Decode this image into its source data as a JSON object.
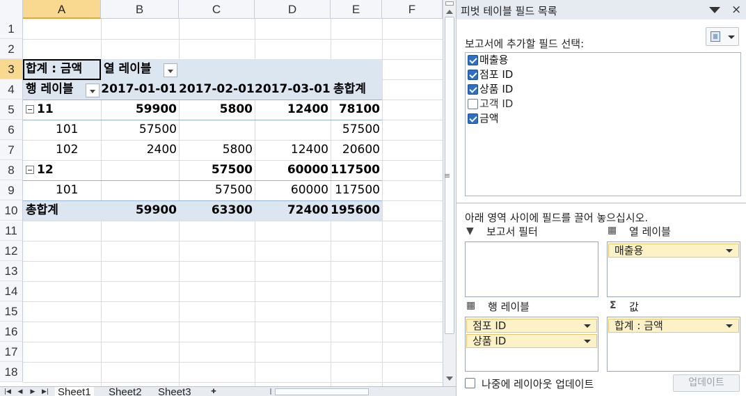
{
  "sheet": {
    "columns": [
      "A",
      "B",
      "C",
      "D",
      "E",
      "F"
    ],
    "rows": [
      "1",
      "2",
      "3",
      "4",
      "5",
      "6",
      "7",
      "8",
      "9",
      "10",
      "11",
      "12",
      "13",
      "14",
      "15",
      "16",
      "17",
      "18"
    ],
    "pivot": {
      "values_label": "합계 : 금액",
      "col_labels_header": "열 레이블",
      "row_labels_header": "행 레이블",
      "col_headers": [
        "2017-01-01",
        "2017-02-01",
        "2017-03-01",
        "총합계"
      ],
      "store_11": {
        "label": "11",
        "vals": [
          "59900",
          "5800",
          "12400",
          "78100"
        ]
      },
      "r101a": {
        "label": "101",
        "vals": [
          "57500",
          "",
          "",
          "57500"
        ]
      },
      "r102": {
        "label": "102",
        "vals": [
          "2400",
          "5800",
          "12400",
          "20600"
        ]
      },
      "store_12": {
        "label": "12",
        "vals": [
          "",
          "57500",
          "60000",
          "117500"
        ]
      },
      "r101b": {
        "label": "101",
        "vals": [
          "",
          "57500",
          "60000",
          "117500"
        ]
      },
      "grand": {
        "label": "총합계",
        "vals": [
          "59900",
          "63300",
          "72400",
          "195600"
        ]
      }
    },
    "tabs": [
      "Sheet1",
      "Sheet2",
      "Sheet3"
    ]
  },
  "pane": {
    "title": "피벗 테이블 필드 목록",
    "close": "×",
    "choose_label": "보고서에 추가할 필드 선택:",
    "fields": [
      {
        "label": "매출용",
        "checked": true
      },
      {
        "label": "점포 ID",
        "checked": true
      },
      {
        "label": "상품 ID",
        "checked": true
      },
      {
        "label": "고객 ID",
        "checked": false
      },
      {
        "label": "금액",
        "checked": true
      }
    ],
    "drag_instruction": "아래 영역 사이에 필드를 끌어 놓으십시오.",
    "report_filter": "보고서 필터",
    "column_labels": "열 레이블",
    "row_labels": "행 레이블",
    "values": "값",
    "values_icon": "Σ",
    "column_chip": "매출용",
    "row_chip_1": "점포 ID",
    "row_chip_2": "상품 ID",
    "value_chip": "합계 : 금액",
    "defer_label": "나중에 레이아웃 업데이트",
    "update_button": "업데이트"
  }
}
